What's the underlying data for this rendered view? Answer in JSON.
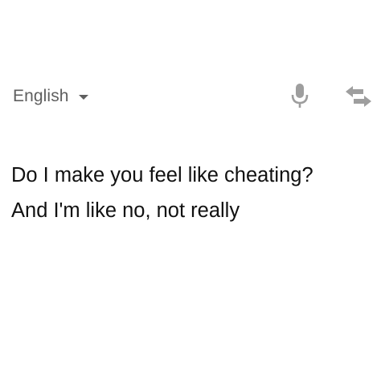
{
  "source_language": {
    "label": "English",
    "dropdown_icon": "caret-down-icon"
  },
  "toolbar": {
    "mic_icon": "microphone-icon",
    "swap_icon": "swap-languages-icon"
  },
  "input_text": {
    "lines": [
      "Do I make you feel like cheating?",
      "And I'm like no, not really"
    ]
  },
  "colors": {
    "background": "#ffffff",
    "label": "#5f5f5f",
    "icon": "#9e9e9e",
    "text": "#111111"
  }
}
